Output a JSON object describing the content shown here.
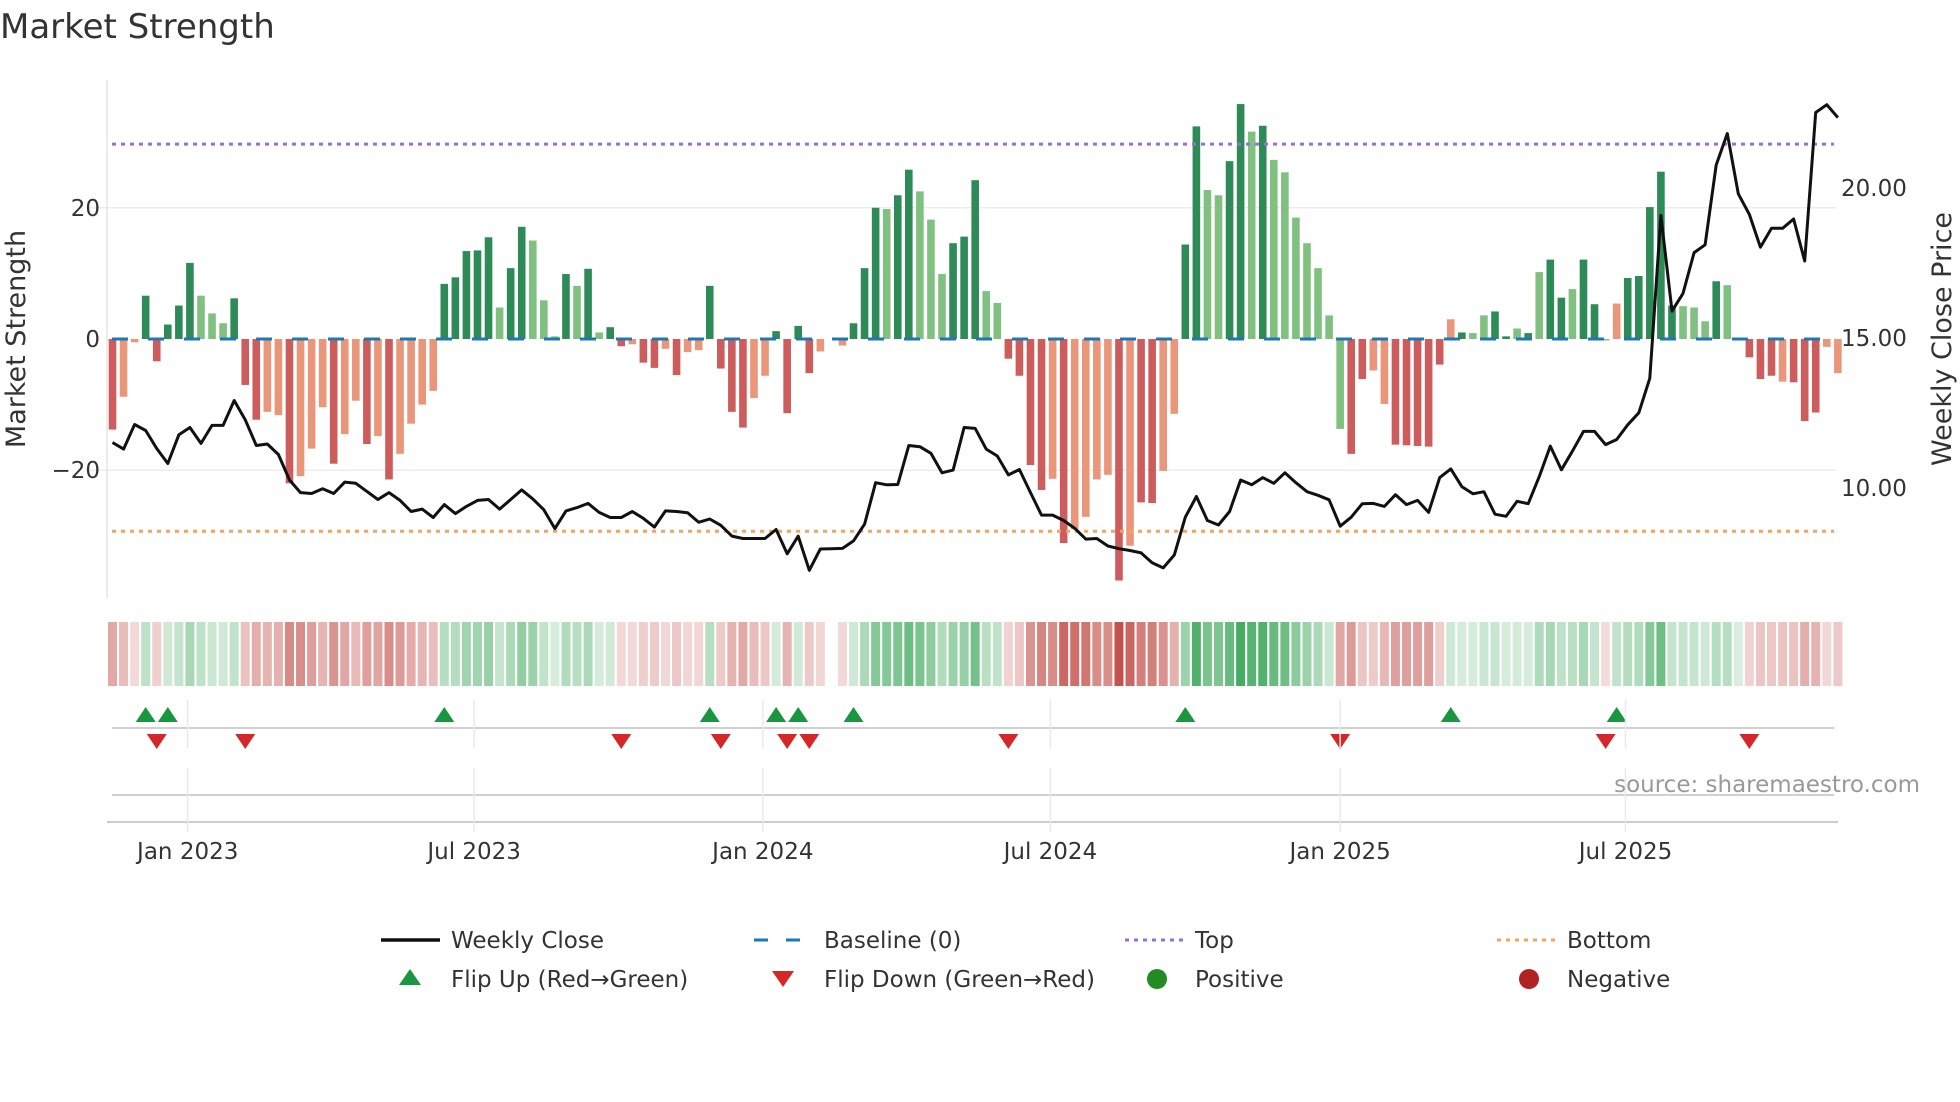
{
  "chart_data": {
    "type": "bar",
    "title": "Market Strength",
    "ylabel_left": "Market Strength",
    "ylabel_right": "Weekly Close Price",
    "ylim_left": [
      -40,
      40
    ],
    "left_ticks": [
      {
        "value": 20,
        "label": "20"
      },
      {
        "value": 0,
        "label": "0"
      },
      {
        "value": -20,
        "label": "−20"
      }
    ],
    "right_ticks": [
      {
        "value": 20,
        "label": "20.00"
      },
      {
        "value": 15,
        "label": "15.00"
      },
      {
        "value": 10,
        "label": "10.00"
      }
    ],
    "x_ticks": [
      {
        "week_index": 6.8,
        "label": "Jan 2023"
      },
      {
        "week_index": 32.7,
        "label": "Jul 2023"
      },
      {
        "week_index": 58.8,
        "label": "Jan 2024"
      },
      {
        "week_index": 84.8,
        "label": "Jul 2024"
      },
      {
        "week_index": 111.0,
        "label": "Jan 2025"
      },
      {
        "week_index": 136.8,
        "label": "Jul 2025"
      }
    ],
    "top_level": 29.7,
    "bottom_level": -29.3,
    "baseline": 0,
    "strength": [
      -13.8,
      -8.8,
      -0.5,
      6.6,
      -3.4,
      2.2,
      5.1,
      11.6,
      6.6,
      3.9,
      2.4,
      6.2,
      -7.0,
      -12.3,
      -11.1,
      -11.6,
      -22,
      -20.9,
      -16.7,
      -10.4,
      -19,
      -14.5,
      -9.4,
      -16,
      -14.8,
      -21.4,
      -17.5,
      -12.9,
      -10,
      -7.9,
      8.4,
      9.4,
      13.4,
      13.5,
      15.5,
      4.8,
      10.8,
      17.1,
      15,
      5.9,
      0.4,
      9.9,
      8.1,
      10.7,
      1,
      1.8,
      -1.1,
      -0.8,
      -3.6,
      -4.4,
      -1.5,
      -5.5,
      -2,
      -1.7,
      8.1,
      -4.5,
      -11.1,
      -13.5,
      -9,
      -5.6,
      1.2,
      -11.3,
      2,
      -5.2,
      -1.9,
      null,
      -1.0,
      2.4,
      10.8,
      20,
      19.8,
      21.9,
      25.8,
      22.5,
      18.2,
      9.9,
      14.6,
      15.6,
      24.2,
      7.3,
      5.5,
      -3,
      -5.6,
      -19.2,
      -23,
      -21.3,
      -31.1,
      -29,
      -27.1,
      -21.4,
      -20.7,
      -36.8,
      -31.5,
      -24.9,
      -25,
      -20.1,
      -11.4,
      14.4,
      32.4,
      22.7,
      21.9,
      27.1,
      35.8,
      31.6,
      32.5,
      27.3,
      25.4,
      18.5,
      14.6,
      10.8,
      3.6,
      -13.7,
      -17.5,
      -6.1,
      -4.8,
      -9.9,
      -16.1,
      -16.2,
      -16.3,
      -16.4,
      -3.9,
      3,
      1,
      0.9,
      3.6,
      4.2,
      0.4,
      1.6,
      0.9,
      10.2,
      12.1,
      6.3,
      7.6,
      12.1,
      5.3,
      -0.1,
      5.4,
      9.3,
      9.6,
      20.1,
      25.5,
      5.1,
      5,
      4.8,
      2.7,
      8.8,
      8.2,
      0.1,
      -2.8,
      -6.1,
      -5.6,
      -6.5,
      -6.6,
      -12.5,
      -11.2,
      -1.2,
      -5.2
    ],
    "bar_color_codes": "RrrGRGGGgggGRRrrRrrrRrrRrRrrrrGGGGGgGGgggGgGgGRrRRrRrrGRRRrrGRGRr-rGGGgGGgggGGGggRRRRrRrrrrRrRRrrGGggGGgGgggggggRRrrRRRRRrGggGGgGgGGgGGgrGGGGGgggGggRRRrRRRrrR",
    "weekly_close": [
      11.5,
      11.28,
      12.1,
      11.9,
      11.3,
      10.8,
      11.76,
      12.0,
      11.47,
      12.07,
      12.07,
      12.9,
      12.26,
      11.4,
      11.45,
      11.1,
      10.25,
      9.83,
      9.8,
      9.96,
      9.8,
      10.18,
      10.14,
      9.87,
      9.6,
      9.83,
      9.57,
      9.2,
      9.28,
      9.0,
      9.43,
      9.13,
      9.37,
      9.57,
      9.6,
      9.28,
      9.6,
      9.92,
      9.62,
      9.26,
      8.63,
      9.22,
      9.33,
      9.47,
      9.17,
      9.0,
      9.0,
      9.2,
      8.97,
      8.68,
      9.22,
      9.2,
      9.16,
      8.84,
      8.95,
      8.74,
      8.38,
      8.3,
      8.3,
      8.3,
      8.6,
      7.79,
      8.38,
      7.24,
      7.95,
      7.96,
      7.97,
      8.22,
      8.78,
      10.16,
      10.09,
      10.1,
      11.4,
      11.36,
      11.14,
      10.49,
      10.58,
      12.0,
      11.97,
      11.28,
      11.05,
      10.42,
      10.6,
      9.83,
      9.08,
      9.08,
      8.9,
      8.64,
      8.28,
      8.3,
      8.05,
      7.96,
      7.9,
      7.82,
      7.49,
      7.32,
      7.75,
      9.01,
      9.7,
      8.9,
      8.75,
      9.2,
      10.25,
      10.09,
      10.33,
      10.14,
      10.49,
      10.16,
      9.86,
      9.74,
      9.59,
      8.71,
      9.01,
      9.46,
      9.47,
      9.37,
      9.76,
      9.43,
      9.57,
      9.17,
      10.33,
      10.62,
      10.03,
      9.79,
      9.86,
      9.11,
      9.04,
      9.54,
      9.46,
      10.36,
      11.38,
      10.59,
      11.21,
      11.87,
      11.87,
      11.43,
      11.6,
      12.09,
      12.49,
      13.64,
      19.07,
      15.88,
      16.47,
      17.83,
      18.09,
      20.75,
      21.8,
      19.79,
      19.1,
      18.01,
      18.64,
      18.64,
      18.95,
      17.55,
      22.5,
      22.76,
      22.33
    ],
    "colors": {
      "G": "#2e8b57",
      "g": "#80c080",
      "R": "#cd5c5c",
      "r": "#e9967a",
      "close": "#111111",
      "baseline": "#1f77b4",
      "top": "#9370db",
      "bottom": "#f4a460",
      "flip_up": "#1a9641",
      "flip_down": "#d62728",
      "positive": "#228b22",
      "negative": "#b22222",
      "strip_pos": "#3fa95c",
      "strip_neg": "#c4524c"
    },
    "legend": [
      {
        "key": "close",
        "label": "Weekly Close"
      },
      {
        "key": "baseline",
        "label": "Baseline (0)"
      },
      {
        "key": "top",
        "label": "Top"
      },
      {
        "key": "bottom",
        "label": "Bottom"
      },
      {
        "key": "flip_up",
        "label": "Flip Up (Red→Green)"
      },
      {
        "key": "flip_down",
        "label": "Flip Down (Green→Red)"
      },
      {
        "key": "positive",
        "label": "Positive"
      },
      {
        "key": "negative",
        "label": "Negative"
      }
    ],
    "legend_placement": "bottom",
    "source": "source: sharemaestro.com"
  }
}
